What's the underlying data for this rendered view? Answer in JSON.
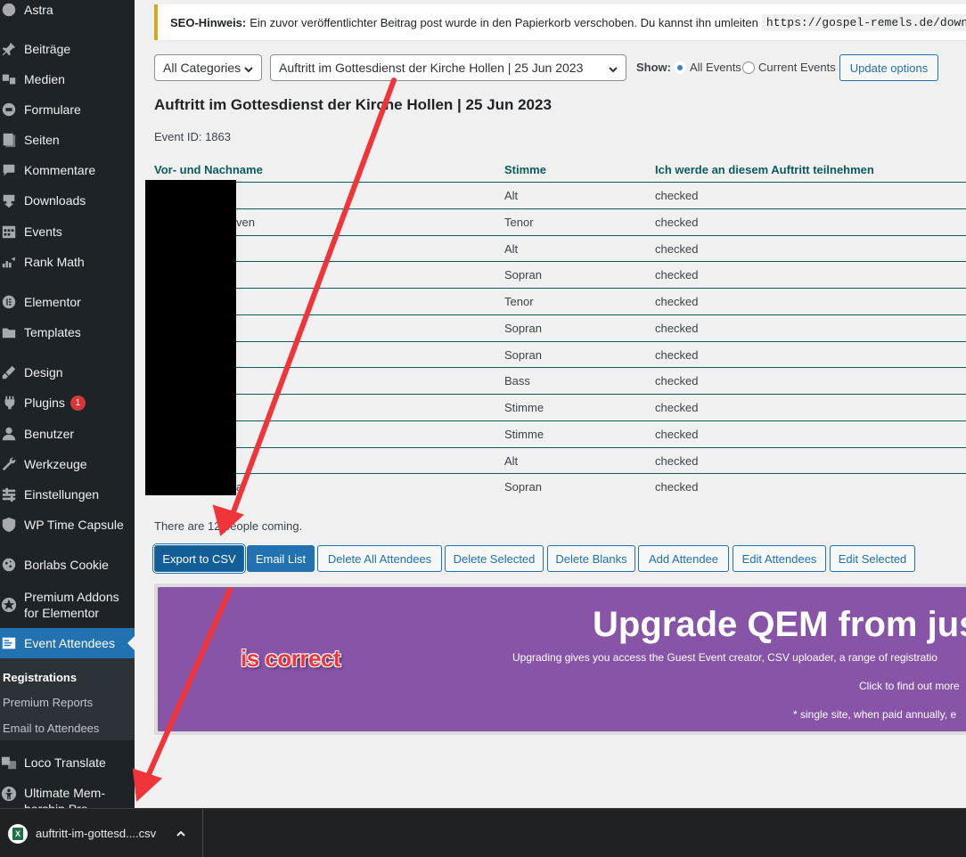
{
  "sidebar": {
    "items": [
      {
        "label": "Astra",
        "icon": "astra-icon"
      },
      {
        "label": "Beiträge",
        "icon": "pin-icon"
      },
      {
        "label": "Medien",
        "icon": "media-icon"
      },
      {
        "label": "Formulare",
        "icon": "forms-icon"
      },
      {
        "label": "Seiten",
        "icon": "pages-icon"
      },
      {
        "label": "Kommentare",
        "icon": "comment-icon"
      },
      {
        "label": "Downloads",
        "icon": "download-icon"
      },
      {
        "label": "Events",
        "icon": "calendar-icon"
      },
      {
        "label": "Rank Math",
        "icon": "rank-math-icon"
      },
      {
        "label": "Elementor",
        "icon": "elementor-icon"
      },
      {
        "label": "Templates",
        "icon": "folder-icon"
      },
      {
        "label": "Design",
        "icon": "brush-icon"
      },
      {
        "label": "Plugins",
        "icon": "plugin-icon",
        "badge": "1"
      },
      {
        "label": "Benutzer",
        "icon": "user-icon"
      },
      {
        "label": "Werkzeuge",
        "icon": "wrench-icon"
      },
      {
        "label": "Einstellungen",
        "icon": "settings-icon"
      },
      {
        "label": "WP Time Capsule",
        "icon": "shield-icon"
      },
      {
        "label": "Borlabs Cookie",
        "icon": "cookie-icon"
      },
      {
        "label": "Premium Addons for Elementor",
        "icon": "star-icon"
      },
      {
        "label": "Event Attendees",
        "icon": "attendees-icon"
      },
      {
        "label": "Loco Translate",
        "icon": "translate-icon"
      },
      {
        "label": "Ultimate Mem-bership Pro",
        "icon": "membership-icon"
      }
    ],
    "submenu": [
      {
        "label": "Registrations"
      },
      {
        "label": "Premium Reports"
      },
      {
        "label": "Email to Attendees"
      }
    ]
  },
  "notice": {
    "label": "SEO-Hinweis:",
    "text": "Ein zuvor veröffentlichter Beitrag post wurde in den Papierkorb verschoben. Du kannst ihn umleiten",
    "url": "https://gospel-remels.de/download"
  },
  "filters": {
    "category": "All Categories",
    "event": "Auftritt im Gottesdienst der Kirche Hollen | 25 Jun 2023",
    "show_label": "Show:",
    "radio_all": "All Events",
    "radio_current": "Current Events",
    "update_button": "Update options"
  },
  "event": {
    "title": "Auftritt im Gottesdienst der Kirche Hollen | 25 Jun 2023",
    "id_text": "Event ID: 1863"
  },
  "table": {
    "headers": [
      "Vor- und Nachname",
      "Stimme",
      "Ich werde an diesem Auftritt teilnehmen"
    ],
    "rows": [
      {
        "name": "",
        "voice": "Alt",
        "attend": "checked"
      },
      {
        "name": "ven",
        "voice": "Tenor",
        "attend": "checked"
      },
      {
        "name": "",
        "voice": "Alt",
        "attend": "checked"
      },
      {
        "name": "",
        "voice": "Sopran",
        "attend": "checked"
      },
      {
        "name": "",
        "voice": "Tenor",
        "attend": "checked"
      },
      {
        "name": "",
        "voice": "Sopran",
        "attend": "checked"
      },
      {
        "name": "",
        "voice": "Sopran",
        "attend": "checked"
      },
      {
        "name": "",
        "voice": "Bass",
        "attend": "checked"
      },
      {
        "name": "",
        "voice": "Stimme",
        "attend": "checked"
      },
      {
        "name": "",
        "voice": "Stimme",
        "attend": "checked"
      },
      {
        "name": "",
        "voice": "Alt",
        "attend": "checked"
      },
      {
        "name": "al",
        "voice": "Sopran",
        "attend": "checked"
      }
    ]
  },
  "people_count": "There are 12 people coming.",
  "actions": [
    {
      "label": "Export to CSV",
      "name": "export-csv-button"
    },
    {
      "label": "Email List",
      "name": "email-list-button"
    },
    {
      "label": "Delete All Attendees",
      "name": "delete-all-button"
    },
    {
      "label": "Delete Selected",
      "name": "delete-selected-button"
    },
    {
      "label": "Delete Blanks",
      "name": "delete-blanks-button"
    },
    {
      "label": "Add Attendee",
      "name": "add-attendee-button"
    },
    {
      "label": "Edit Attendees",
      "name": "edit-attendees-button"
    },
    {
      "label": "Edit Selected",
      "name": "edit-selected-button"
    }
  ],
  "upgrade": {
    "title": "Upgrade QEM from jus",
    "desc": "Upgrading gives you access the Guest Event creator, CSV uploader, a range of registratio",
    "cta": "Click to find out more",
    "note": "* single site, when paid annually, e"
  },
  "annotation": "is correct",
  "download_bar": {
    "filename": "auftritt-im-gottesd....csv",
    "icon": "excel-icon"
  },
  "colors": {
    "sidebar_bg": "#1d2327",
    "accent": "#2271b1",
    "upgrade_bg": "#8754a8",
    "arrow": "#f0343a"
  }
}
